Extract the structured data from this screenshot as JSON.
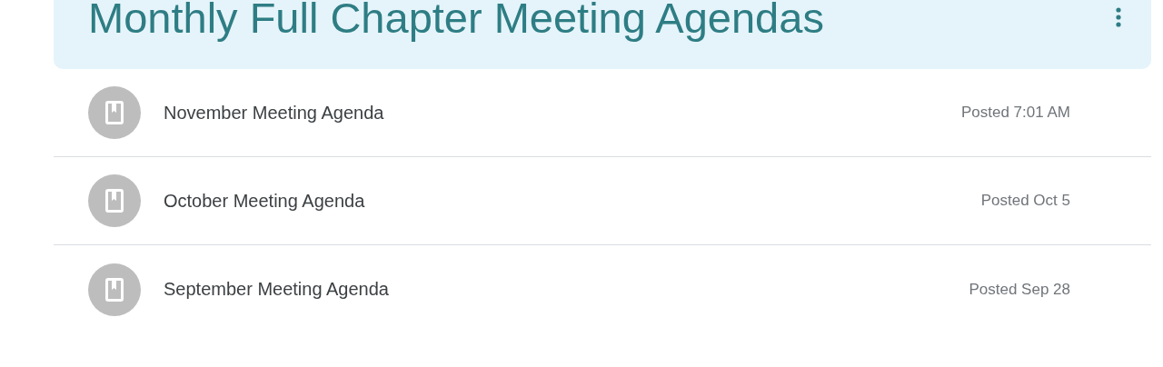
{
  "header": {
    "title": "Monthly Full Chapter Meeting Agendas"
  },
  "items": [
    {
      "title": "November Meeting Agenda",
      "posted": "Posted 7:01 AM"
    },
    {
      "title": "October Meeting Agenda",
      "posted": "Posted Oct 5"
    },
    {
      "title": "September Meeting Agenda",
      "posted": "Posted Sep 28"
    }
  ]
}
